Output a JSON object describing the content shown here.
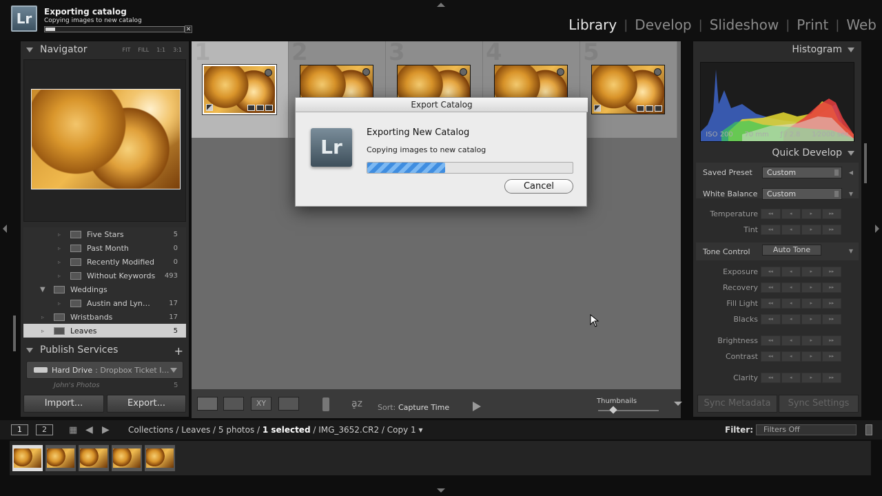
{
  "status": {
    "title": "Exporting catalog",
    "subtitle": "Copying images to new catalog",
    "progress": 0.07
  },
  "app": {
    "logo": "Lr"
  },
  "modules": [
    "Library",
    "Develop",
    "Slideshow",
    "Print",
    "Web"
  ],
  "active_module": "Library",
  "navigator": {
    "title": "Navigator",
    "zoom": [
      "FIT",
      "FILL",
      "1:1",
      "3:1"
    ]
  },
  "collections": [
    {
      "label": "Five Stars",
      "count": "5"
    },
    {
      "label": "Past Month",
      "count": "0"
    },
    {
      "label": "Recently Modified",
      "count": "0"
    },
    {
      "label": "Without Keywords",
      "count": "493"
    },
    {
      "label": "Weddings",
      "count": ""
    },
    {
      "label": "Austin and Lyn…",
      "count": "17"
    },
    {
      "label": "Wristbands",
      "count": "17"
    },
    {
      "label": "Leaves",
      "count": "5"
    }
  ],
  "publish": {
    "title": "Publish Services",
    "drive_label": "Hard Drive",
    "drive_sub": ": Dropbox Ticket I…",
    "next_item": "John's Photos",
    "next_count": "5"
  },
  "buttons": {
    "import": "Import...",
    "export": "Export..."
  },
  "grid_numbers": [
    "1",
    "2",
    "3",
    "4",
    "5"
  ],
  "dialog": {
    "title": "Export Catalog",
    "logo": "Lr",
    "heading": "Exporting New Catalog",
    "message": "Copying images to new catalog",
    "progress": 0.38,
    "cancel": "Cancel"
  },
  "toolbar": {
    "sort_label": "Sort:",
    "sort_value": "Capture Time",
    "thumbnails_label": "Thumbnails"
  },
  "histogram": {
    "title": "Histogram",
    "iso": "ISO 200",
    "focal": "70 mm",
    "aperture": "ƒ / 2.8",
    "shutter": "1⁄2000 sec"
  },
  "quick_develop": {
    "title": "Quick Develop",
    "saved_preset_label": "Saved Preset",
    "saved_preset_value": "Custom",
    "white_balance_label": "White Balance",
    "white_balance_value": "Custom",
    "temperature": "Temperature",
    "tint": "Tint",
    "tone_control": "Tone Control",
    "auto_tone": "Auto Tone",
    "exposure": "Exposure",
    "recovery": "Recovery",
    "fill_light": "Fill Light",
    "blacks": "Blacks",
    "brightness": "Brightness",
    "contrast": "Contrast",
    "clarity": "Clarity",
    "step_glyphs": [
      "◂◂",
      "◂",
      "▸",
      "▸▸"
    ]
  },
  "sync": {
    "metadata": "Sync Metadata",
    "settings": "Sync Settings"
  },
  "filmstrip_bar": {
    "screen1": "1",
    "screen2": "2",
    "crumb_path": "Collections / Leaves / 5 photos / ",
    "crumb_selected": "1 selected",
    "crumb_file": " / IMG_3652.CR2 / Copy 1 ▾",
    "filter_label": "Filter:",
    "filter_value": "Filters Off"
  }
}
